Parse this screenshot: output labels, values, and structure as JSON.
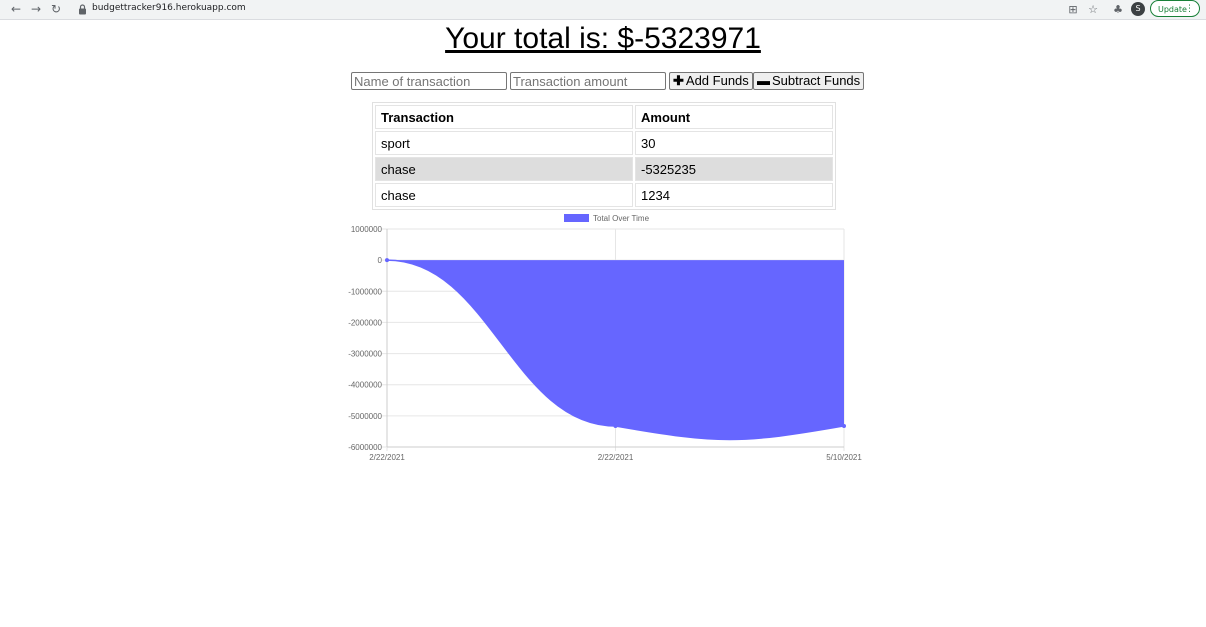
{
  "browser": {
    "url": "budgettracker916.herokuapp.com",
    "profile_initial": "S",
    "update_label": "Update"
  },
  "header": {
    "total_text": "Your total is: $-5323971"
  },
  "form": {
    "name_placeholder": "Name of transaction",
    "amount_placeholder": "Transaction amount",
    "add_label": "Add Funds",
    "subtract_label": "Subtract Funds"
  },
  "table": {
    "headers": [
      "Transaction",
      "Amount"
    ],
    "rows": [
      {
        "name": "sport",
        "amount": "30"
      },
      {
        "name": "chase",
        "amount": "-5325235"
      },
      {
        "name": "chase",
        "amount": "1234"
      }
    ]
  },
  "chart_data": {
    "type": "area",
    "legend": [
      "Total Over Time"
    ],
    "legend_position": "top",
    "fill_color": "#6666ff",
    "categories": [
      "2/22/2021",
      "2/22/2021",
      "5/10/2021"
    ],
    "series": [
      {
        "name": "Total Over Time",
        "values": [
          0,
          -5325235,
          -5324001
        ]
      }
    ],
    "ylim": [
      -6000000,
      1000000
    ],
    "yticks": [
      1000000,
      0,
      -1000000,
      -2000000,
      -3000000,
      -4000000,
      -5000000,
      -6000000
    ],
    "grid": true
  }
}
